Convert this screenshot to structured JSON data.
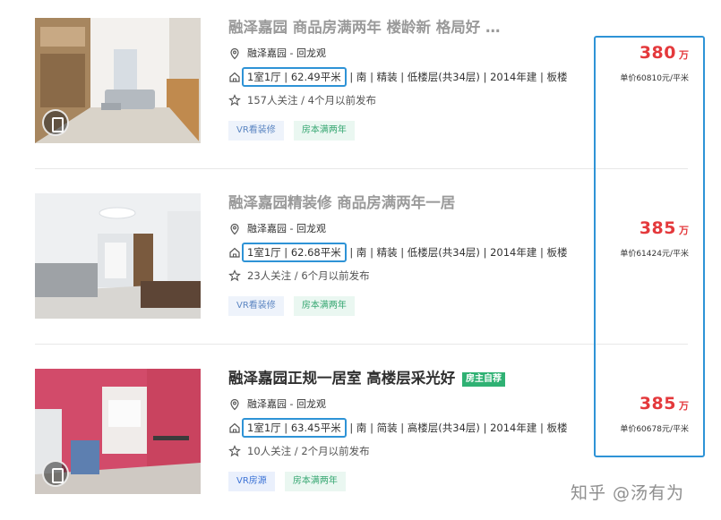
{
  "listings": [
    {
      "title": "融泽嘉园 商品房满两年 楼龄新 格局好 …",
      "address": "融泽嘉园 - 回龙观",
      "layout_area": "1室1厅 | 62.49平米",
      "details": "| 南 | 精装 | 低楼层(共34层) | 2014年建 | 板楼",
      "follow": "157人关注 / 4个月以前发布",
      "tags": [
        "VR看装修",
        "房本满两年"
      ],
      "total_price": "380",
      "price_unit": "万",
      "unit_price": "单价60810元/平米",
      "icons": [
        "location-pin-icon",
        "house-icon",
        "star-icon",
        "vr-icon"
      ]
    },
    {
      "title": "融泽嘉园精装修 商品房满两年一居",
      "address": "融泽嘉园 - 回龙观",
      "layout_area": "1室1厅 | 62.68平米",
      "details": "| 南 | 精装 | 低楼层(共34层) | 2014年建 | 板楼",
      "follow": "23人关注 / 6个月以前发布",
      "tags": [
        "VR看装修",
        "房本满两年"
      ],
      "total_price": "385",
      "price_unit": "万",
      "unit_price": "单价61424元/平米",
      "icons": [
        "location-pin-icon",
        "house-icon",
        "star-icon"
      ]
    },
    {
      "title": "融泽嘉园正规一居室 高楼层采光好",
      "badge": "房主自荐",
      "address": "融泽嘉园 - 回龙观",
      "layout_area": "1室1厅 | 63.45平米",
      "details": "| 南 | 简装 | 高楼层(共34层) | 2014年建 | 板楼",
      "follow": "10人关注 / 2个月以前发布",
      "tags": [
        "VR房源",
        "房本满两年"
      ],
      "total_price": "385",
      "price_unit": "万",
      "unit_price": "单价60678元/平米",
      "icons": [
        "location-pin-icon",
        "house-icon",
        "star-icon",
        "vr-icon"
      ]
    }
  ],
  "watermark": "知乎 @汤有为",
  "colors": {
    "price_red": "#e4393c",
    "highlight_blue": "#2e93d6",
    "badge_green": "#2fb173"
  }
}
